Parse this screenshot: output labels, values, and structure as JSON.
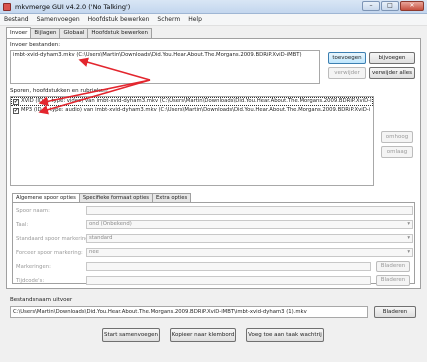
{
  "window": {
    "title": "mkvmerge GUI v4.2.0 ('No Talking')",
    "minimize": "–",
    "maximize": "□",
    "close": "✕"
  },
  "menu": [
    "Bestand",
    "Samenvoegen",
    "Hoofdstuk bewerken",
    "Scherm",
    "Help"
  ],
  "tabs": [
    "Invoer",
    "Bijlagen",
    "Globaal",
    "Hoofdstuk bewerken"
  ],
  "input": {
    "label": "Invoer bestanden:",
    "files": [
      "imbt-xvid-dyham3.mkv (C:\\Users\\Martin\\Downloads\\Did.You.Hear.About.The.Morgans.2009.BDRiP.XviD-iMBT)"
    ],
    "btn_add": "toevoegen",
    "btn_append": "bijvoegen",
    "btn_remove": "verwijder",
    "btn_remove_all": "verwijder alles"
  },
  "tracks": {
    "label": "Sporen, hoofdstukken en rubrieken:",
    "rows": [
      {
        "checked": "✔",
        "text": "XViD (ID 0, type: video) van imbt-xvid-dyham3.mkv (C:\\Users\\Martin\\Downloads\\Did.You.Hear.About.The.Morgans.2009.BDRiP.XviD-i"
      },
      {
        "checked": "✔",
        "text": "MP3 (ID 1, type: audio) van imbt-xvid-dyham3.mkv (C:\\Users\\Martin\\Downloads\\Did.You.Hear.About.The.Morgans.2009.BDRiP.XviD-i"
      }
    ],
    "btn_up": "omhoog",
    "btn_down": "omlaag"
  },
  "options": {
    "tabs": [
      "Algemene spoor opties",
      "Specifieke formaat opties",
      "Extra opties"
    ],
    "fields": [
      {
        "label": "Spoor naam:",
        "value": ""
      },
      {
        "label": "Taal:",
        "value": "ond (Onbekend)"
      },
      {
        "label": "Standaard spoor markering:",
        "value": "standard"
      },
      {
        "label": "Forceer spoor markering:",
        "value": "nee"
      },
      {
        "label": "Markeringen:",
        "value": ""
      },
      {
        "label": "Tijdcode's:",
        "value": ""
      }
    ],
    "browse_label": "Bladeren"
  },
  "output": {
    "label": "Bestandsnaam uitvoer",
    "value": "C:\\Users\\Martin\\Downloads\\Did.You.Hear.About.The.Morgans.2009.BDRiP.XviD-iMBT\\imbt-xvid-dyham3 (1).mkv",
    "browse": "Bladeren"
  },
  "actions": {
    "start": "Start samenvoegen",
    "copy": "Kopieer naar klembord",
    "add_queue": "Voeg toe aan taak wachtrij"
  },
  "colors": {
    "annotation_arrow": "#e3262e",
    "primary_button": "#3c7fb1"
  }
}
